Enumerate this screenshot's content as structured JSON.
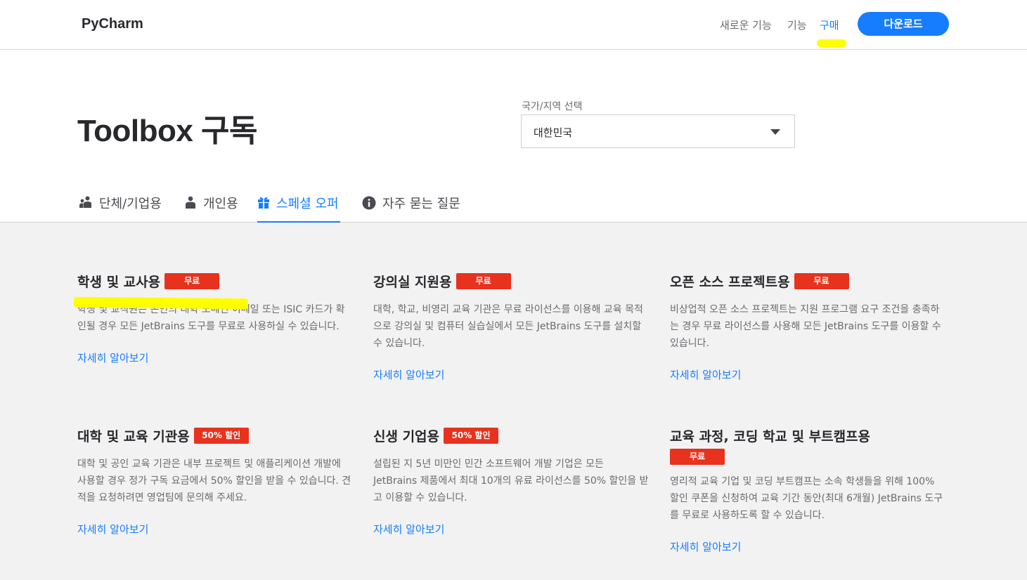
{
  "header": {
    "brand": "PyCharm",
    "nav": {
      "whats_new": "새로운 기능",
      "features": "기능",
      "buy": "구매"
    },
    "download_label": "다운로드"
  },
  "page": {
    "title": "Toolbox 구독",
    "country_label": "국가/지역 선택",
    "country_value": "대한민국"
  },
  "tabs": [
    {
      "label": "단체/기업용",
      "icon": "team-icon",
      "active": false
    },
    {
      "label": "개인용",
      "icon": "person-icon",
      "active": false
    },
    {
      "label": "스페셜 오퍼",
      "icon": "gift-icon",
      "active": true
    },
    {
      "label": "자주 묻는 질문",
      "icon": "info-icon",
      "active": false
    }
  ],
  "offers": [
    {
      "title": "학생 및 교사용",
      "badge": "무료",
      "description": "학생 및 교직원은 본인의 대학 도메인 이메일 또는 ISIC 카드가 확인될 경우 모든 JetBrains 도구를 무료로 사용하실 수 있습니다.",
      "link": "자세히 알아보기"
    },
    {
      "title": "강의실 지원용",
      "badge": "무료",
      "description": "대학, 학교, 비영리 교육 기관은 무료 라이선스를 이용해 교육 목적으로 강의실 및 컴퓨터 실습실에서 모든 JetBrains 도구를 설치할 수 있습니다.",
      "link": "자세히 알아보기"
    },
    {
      "title": "오픈 소스 프로젝트용",
      "badge": "무료",
      "description": "비상업적 오픈 소스 프로젝트는 지원 프로그램 요구 조건을 충족하는 경우 무료 라이선스를 사용해 모든 JetBrains 도구를 이용할 수 있습니다.",
      "link": "자세히 알아보기"
    },
    {
      "title": "대학 및 교육 기관용",
      "badge": "50% 할인",
      "description": "대학 및 공인 교육 기관은 내부 프로젝트 및 애플리케이션 개발에 사용할 경우 정가 구독 요금에서 50% 할인을 받을 수 있습니다. 견적을 요청하려면 영업팀에 문의해 주세요.",
      "link": "자세히 알아보기"
    },
    {
      "title": "신생 기업용",
      "badge": "50% 할인",
      "description": "설립된 지 5년 미만인 민간 소프트웨어 개발 기업은 모든 JetBrains 제품에서 최대 10개의 유료 라이선스를 50% 할인을 받고 이용할 수 있습니다.",
      "link": "자세히 알아보기"
    },
    {
      "title": "교육 과정, 코딩 학교 및 부트캠프용",
      "badge": "무료",
      "description": "영리적 교육 기업 및 코딩 부트캠프는 소속 학생들을 위해 100% 할인 쿠폰을 신청하여 교육 기간 동안(최대 6개월) JetBrains 도구를 무료로 사용하도록 할 수 있습니다.",
      "link": "자세히 알아보기"
    }
  ],
  "colors": {
    "accent": "#167dff",
    "badge": "#e8321e",
    "highlight": "#ffff00"
  }
}
